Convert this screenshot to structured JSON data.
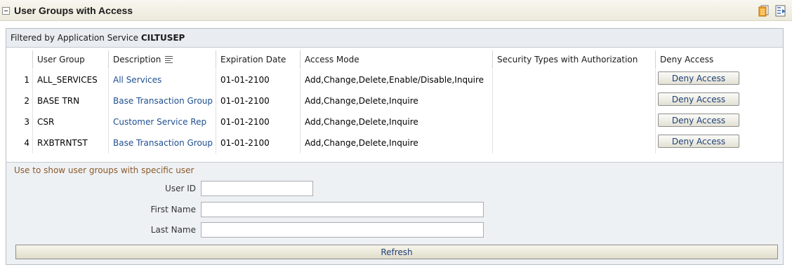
{
  "panel": {
    "title": "User Groups with Access",
    "icons": [
      "collapse-icon",
      "export-icon",
      "detach-icon"
    ]
  },
  "filter": {
    "prefix": "Filtered by Application Service",
    "service": "CILTUSEP"
  },
  "table": {
    "columns": [
      "",
      "User Group",
      "Description",
      "Expiration Date",
      "Access Mode",
      "Security Types with Authorization",
      "Deny Access"
    ],
    "rows": [
      {
        "num": "1",
        "group": "ALL_SERVICES",
        "description": "All Services",
        "expiration": "01-01-2100",
        "mode": "Add,Change,Delete,Enable/Disable,Inquire",
        "security": "",
        "deny": "Deny Access"
      },
      {
        "num": "2",
        "group": "BASE TRN",
        "description": "Base Transaction Group",
        "expiration": "01-01-2100",
        "mode": "Add,Change,Delete,Inquire",
        "security": "",
        "deny": "Deny Access"
      },
      {
        "num": "3",
        "group": "CSR",
        "description": "Customer Service Rep",
        "expiration": "01-01-2100",
        "mode": "Add,Change,Delete,Inquire",
        "security": "",
        "deny": "Deny Access"
      },
      {
        "num": "4",
        "group": "RXBTRNTST",
        "description": "Base Transaction Group",
        "expiration": "01-01-2100",
        "mode": "Add,Change,Delete,Inquire",
        "security": "",
        "deny": "Deny Access"
      }
    ]
  },
  "search": {
    "caption": "Use to show user groups with specific user",
    "user_id_label": "User ID",
    "user_id_value": "",
    "first_name_label": "First Name",
    "first_name_value": "",
    "last_name_label": "Last Name",
    "last_name_value": "",
    "refresh_label": "Refresh"
  }
}
